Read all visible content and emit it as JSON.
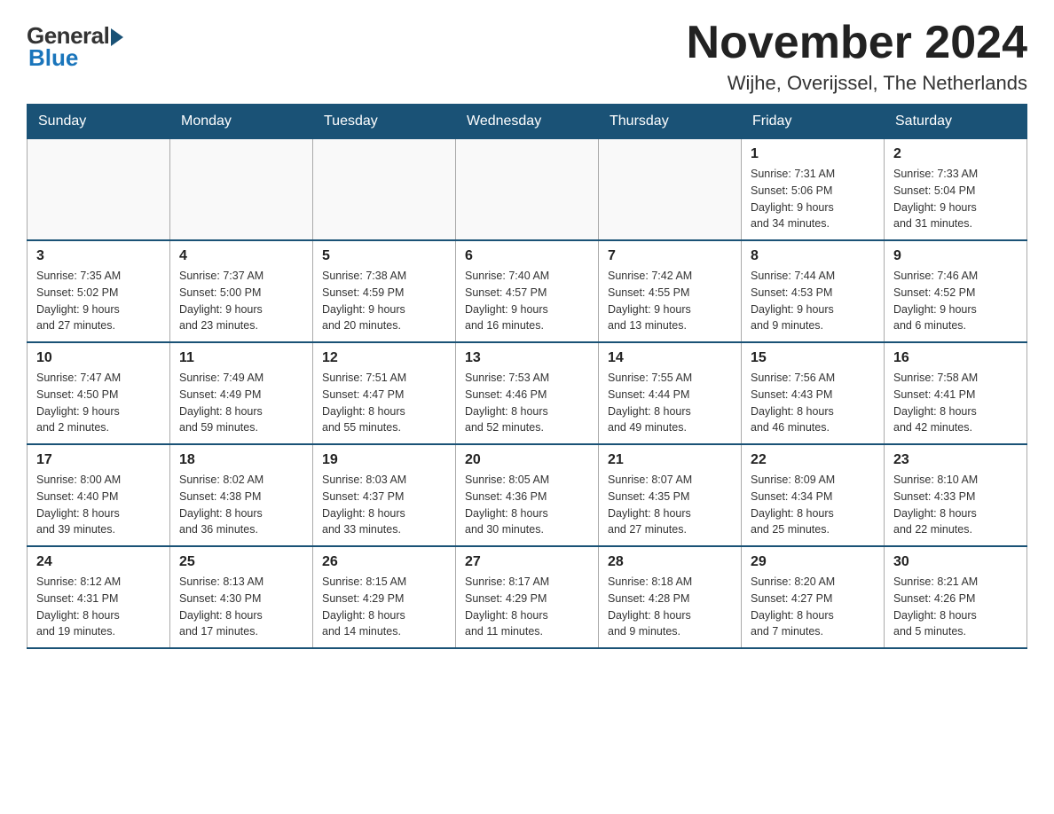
{
  "logo": {
    "general": "General",
    "blue": "Blue"
  },
  "header": {
    "month_year": "November 2024",
    "location": "Wijhe, Overijssel, The Netherlands"
  },
  "days_of_week": [
    "Sunday",
    "Monday",
    "Tuesday",
    "Wednesday",
    "Thursday",
    "Friday",
    "Saturday"
  ],
  "weeks": [
    [
      {
        "day": "",
        "info": ""
      },
      {
        "day": "",
        "info": ""
      },
      {
        "day": "",
        "info": ""
      },
      {
        "day": "",
        "info": ""
      },
      {
        "day": "",
        "info": ""
      },
      {
        "day": "1",
        "info": "Sunrise: 7:31 AM\nSunset: 5:06 PM\nDaylight: 9 hours\nand 34 minutes."
      },
      {
        "day": "2",
        "info": "Sunrise: 7:33 AM\nSunset: 5:04 PM\nDaylight: 9 hours\nand 31 minutes."
      }
    ],
    [
      {
        "day": "3",
        "info": "Sunrise: 7:35 AM\nSunset: 5:02 PM\nDaylight: 9 hours\nand 27 minutes."
      },
      {
        "day": "4",
        "info": "Sunrise: 7:37 AM\nSunset: 5:00 PM\nDaylight: 9 hours\nand 23 minutes."
      },
      {
        "day": "5",
        "info": "Sunrise: 7:38 AM\nSunset: 4:59 PM\nDaylight: 9 hours\nand 20 minutes."
      },
      {
        "day": "6",
        "info": "Sunrise: 7:40 AM\nSunset: 4:57 PM\nDaylight: 9 hours\nand 16 minutes."
      },
      {
        "day": "7",
        "info": "Sunrise: 7:42 AM\nSunset: 4:55 PM\nDaylight: 9 hours\nand 13 minutes."
      },
      {
        "day": "8",
        "info": "Sunrise: 7:44 AM\nSunset: 4:53 PM\nDaylight: 9 hours\nand 9 minutes."
      },
      {
        "day": "9",
        "info": "Sunrise: 7:46 AM\nSunset: 4:52 PM\nDaylight: 9 hours\nand 6 minutes."
      }
    ],
    [
      {
        "day": "10",
        "info": "Sunrise: 7:47 AM\nSunset: 4:50 PM\nDaylight: 9 hours\nand 2 minutes."
      },
      {
        "day": "11",
        "info": "Sunrise: 7:49 AM\nSunset: 4:49 PM\nDaylight: 8 hours\nand 59 minutes."
      },
      {
        "day": "12",
        "info": "Sunrise: 7:51 AM\nSunset: 4:47 PM\nDaylight: 8 hours\nand 55 minutes."
      },
      {
        "day": "13",
        "info": "Sunrise: 7:53 AM\nSunset: 4:46 PM\nDaylight: 8 hours\nand 52 minutes."
      },
      {
        "day": "14",
        "info": "Sunrise: 7:55 AM\nSunset: 4:44 PM\nDaylight: 8 hours\nand 49 minutes."
      },
      {
        "day": "15",
        "info": "Sunrise: 7:56 AM\nSunset: 4:43 PM\nDaylight: 8 hours\nand 46 minutes."
      },
      {
        "day": "16",
        "info": "Sunrise: 7:58 AM\nSunset: 4:41 PM\nDaylight: 8 hours\nand 42 minutes."
      }
    ],
    [
      {
        "day": "17",
        "info": "Sunrise: 8:00 AM\nSunset: 4:40 PM\nDaylight: 8 hours\nand 39 minutes."
      },
      {
        "day": "18",
        "info": "Sunrise: 8:02 AM\nSunset: 4:38 PM\nDaylight: 8 hours\nand 36 minutes."
      },
      {
        "day": "19",
        "info": "Sunrise: 8:03 AM\nSunset: 4:37 PM\nDaylight: 8 hours\nand 33 minutes."
      },
      {
        "day": "20",
        "info": "Sunrise: 8:05 AM\nSunset: 4:36 PM\nDaylight: 8 hours\nand 30 minutes."
      },
      {
        "day": "21",
        "info": "Sunrise: 8:07 AM\nSunset: 4:35 PM\nDaylight: 8 hours\nand 27 minutes."
      },
      {
        "day": "22",
        "info": "Sunrise: 8:09 AM\nSunset: 4:34 PM\nDaylight: 8 hours\nand 25 minutes."
      },
      {
        "day": "23",
        "info": "Sunrise: 8:10 AM\nSunset: 4:33 PM\nDaylight: 8 hours\nand 22 minutes."
      }
    ],
    [
      {
        "day": "24",
        "info": "Sunrise: 8:12 AM\nSunset: 4:31 PM\nDaylight: 8 hours\nand 19 minutes."
      },
      {
        "day": "25",
        "info": "Sunrise: 8:13 AM\nSunset: 4:30 PM\nDaylight: 8 hours\nand 17 minutes."
      },
      {
        "day": "26",
        "info": "Sunrise: 8:15 AM\nSunset: 4:29 PM\nDaylight: 8 hours\nand 14 minutes."
      },
      {
        "day": "27",
        "info": "Sunrise: 8:17 AM\nSunset: 4:29 PM\nDaylight: 8 hours\nand 11 minutes."
      },
      {
        "day": "28",
        "info": "Sunrise: 8:18 AM\nSunset: 4:28 PM\nDaylight: 8 hours\nand 9 minutes."
      },
      {
        "day": "29",
        "info": "Sunrise: 8:20 AM\nSunset: 4:27 PM\nDaylight: 8 hours\nand 7 minutes."
      },
      {
        "day": "30",
        "info": "Sunrise: 8:21 AM\nSunset: 4:26 PM\nDaylight: 8 hours\nand 5 minutes."
      }
    ]
  ]
}
